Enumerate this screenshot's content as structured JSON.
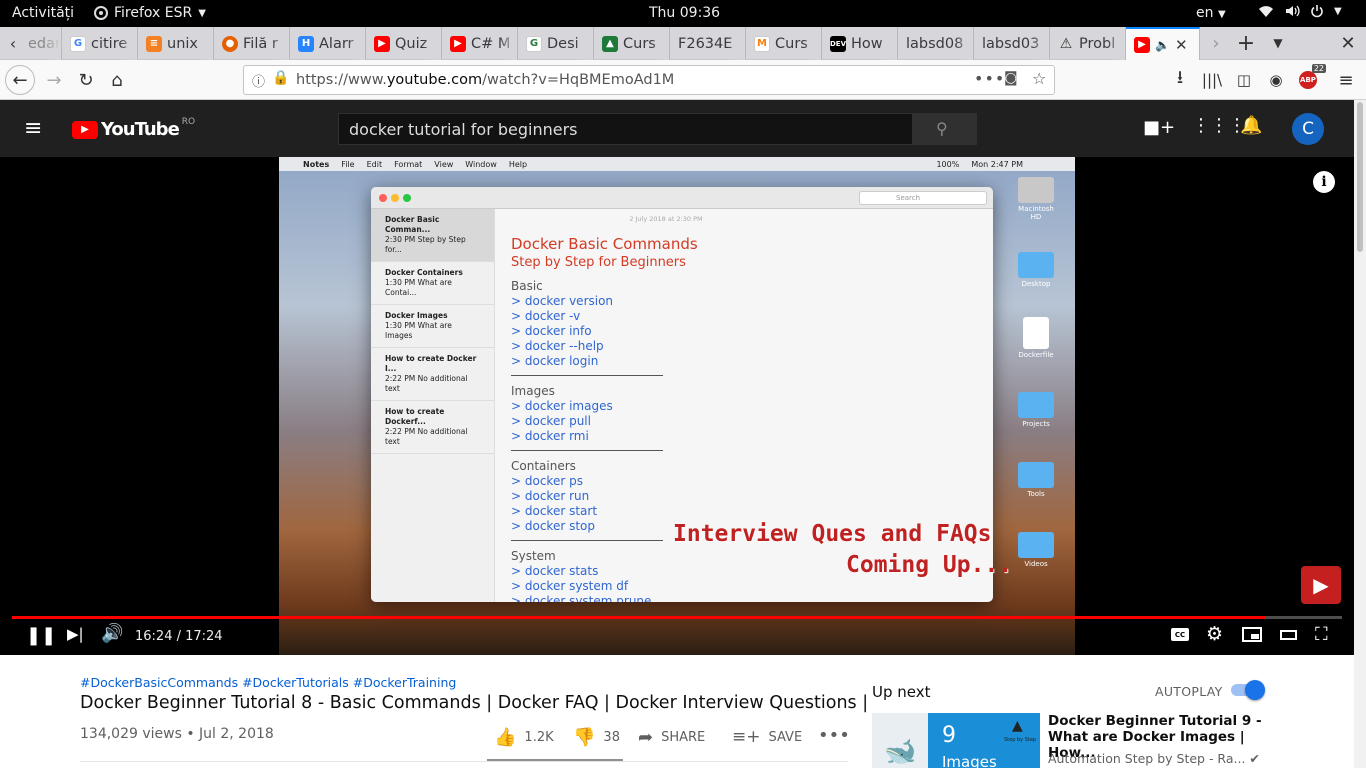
{
  "topbar": {
    "activities": "Activități",
    "app": "Firefox ESR",
    "clock": "Thu 09:36",
    "lang": "en"
  },
  "tabs": [
    {
      "label": "edar",
      "favicon": "generic"
    },
    {
      "label": "citire",
      "favicon": "google"
    },
    {
      "label": "unix",
      "favicon": "stackoverflow"
    },
    {
      "label": "Filă r",
      "favicon": "firefox"
    },
    {
      "label": "Alarr",
      "favicon": "atlassian"
    },
    {
      "label": "Quiz",
      "favicon": "youtube"
    },
    {
      "label": "C# M",
      "favicon": "youtube"
    },
    {
      "label": "Desi",
      "favicon": "gg"
    },
    {
      "label": "Curs",
      "favicon": "coursera"
    },
    {
      "label": "F2634E",
      "favicon": "none"
    },
    {
      "label": "Curs",
      "favicon": "moodle"
    },
    {
      "label": "How",
      "favicon": "dev"
    },
    {
      "label": "labsd08",
      "favicon": "none"
    },
    {
      "label": "labsd03",
      "favicon": "none"
    },
    {
      "label": "Probl",
      "favicon": "warning"
    }
  ],
  "nav": {
    "url_prefix": "https://www.",
    "url_domain": "youtube.com",
    "url_path": "/watch?v=HqBMEmoAd1M",
    "ext_badge": "22"
  },
  "youtube": {
    "logo": "YouTube",
    "country": "RO",
    "search_value": "docker tutorial for beginners",
    "avatar_letter": "C"
  },
  "video_frame": {
    "mac_menu": [
      "Notes",
      "File",
      "Edit",
      "Format",
      "View",
      "Window",
      "Help"
    ],
    "mac_clock": "Mon 2:47 PM",
    "mac_battery": "100%",
    "search_placeholder": "Search",
    "notes_list": [
      {
        "title": "Docker Basic Comman...",
        "sub": "2:30 PM  Step by Step for..."
      },
      {
        "title": "Docker Containers",
        "sub": "1:30 PM  What are Contai..."
      },
      {
        "title": "Docker Images",
        "sub": "1:30 PM  What are Images"
      },
      {
        "title": "How to create Docker I...",
        "sub": "2:22 PM  No additional text"
      },
      {
        "title": "How to create Dockerf...",
        "sub": "2:22 PM  No additional text"
      }
    ],
    "note_date": "2 July 2018 at 2:30 PM",
    "note_title": "Docker Basic Commands",
    "note_subtitle": "Step by Step for Beginners",
    "sections": [
      {
        "name": "Basic",
        "cmds": [
          "> docker version",
          "> docker -v",
          "> docker info",
          "> docker --help",
          "> docker login"
        ]
      },
      {
        "name": "Images",
        "cmds": [
          "> docker images",
          "> docker pull",
          "> docker rmi"
        ]
      },
      {
        "name": "Containers",
        "cmds": [
          "> docker ps",
          "> docker run",
          "> docker start",
          "> docker stop"
        ]
      },
      {
        "name": "System",
        "cmds": [
          "> docker stats",
          "> docker system df",
          "> docker system prune"
        ]
      }
    ],
    "overlay_line1": "Interview Ques and FAQs",
    "overlay_line2": "Coming Up...",
    "desktop_icons": [
      "Macintosh HD",
      "Desktop",
      "Dockerfile",
      "Projects",
      "Tools",
      "Videos"
    ]
  },
  "player": {
    "time": "16:24 / 17:24",
    "progress": 0.943
  },
  "video": {
    "hashtags": "#DockerBasicCommands #DockerTutorials #DockerTraining",
    "title": "Docker Beginner Tutorial 8 - Basic Commands | Docker FAQ | Docker Interview Questions |",
    "meta": "134,029 views • Jul 2, 2018",
    "likes": "1.2K",
    "dislikes": "38",
    "share": "SHARE",
    "save": "SAVE"
  },
  "sidebar": {
    "up_next": "Up next",
    "autoplay": "AUTOPLAY",
    "autoplay_on": true,
    "rec_title": "Docker Beginner Tutorial 9 - What are Docker Images | How...",
    "rec_channel": "Automation Step by Step - Ra...",
    "rec_thumb_num": "9",
    "rec_thumb_word": "Images",
    "rec_thumb_brand": "Step by Step"
  },
  "colors": {
    "accent_red": "#ff0000",
    "firefox_blue": "#0a84ff",
    "yt_dark": "#202020",
    "link_blue": "#065fd4"
  }
}
